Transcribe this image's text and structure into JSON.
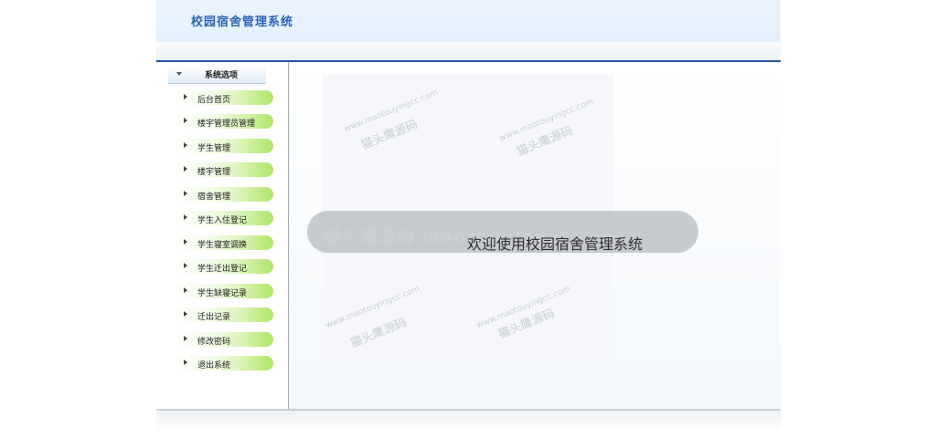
{
  "header": {
    "title": "校园宿舍管理系统"
  },
  "sidebar": {
    "section_title": "系统选项",
    "items": [
      {
        "label": "后台首页"
      },
      {
        "label": "楼宇管理员管理"
      },
      {
        "label": "学生管理"
      },
      {
        "label": "楼宇管理"
      },
      {
        "label": "宿舍管理"
      },
      {
        "label": "学生入住登记"
      },
      {
        "label": "学生寝室调换"
      },
      {
        "label": "学生迁出登记"
      },
      {
        "label": "学生缺寝记录"
      },
      {
        "label": "迁出记录"
      },
      {
        "label": "修改密码"
      },
      {
        "label": "退出系统"
      }
    ]
  },
  "main": {
    "welcome": "欢迎使用校园宿舍管理系统",
    "watermark_text": "猫头鹰源码 maotouyingcc.com",
    "watermark_small": "www.maotouyingcc.com",
    "watermark_cn": "猫头鹰源码"
  },
  "colors": {
    "title": "#2a62b8",
    "header_line": "#1f57a3",
    "menu_green": "#ace665"
  }
}
